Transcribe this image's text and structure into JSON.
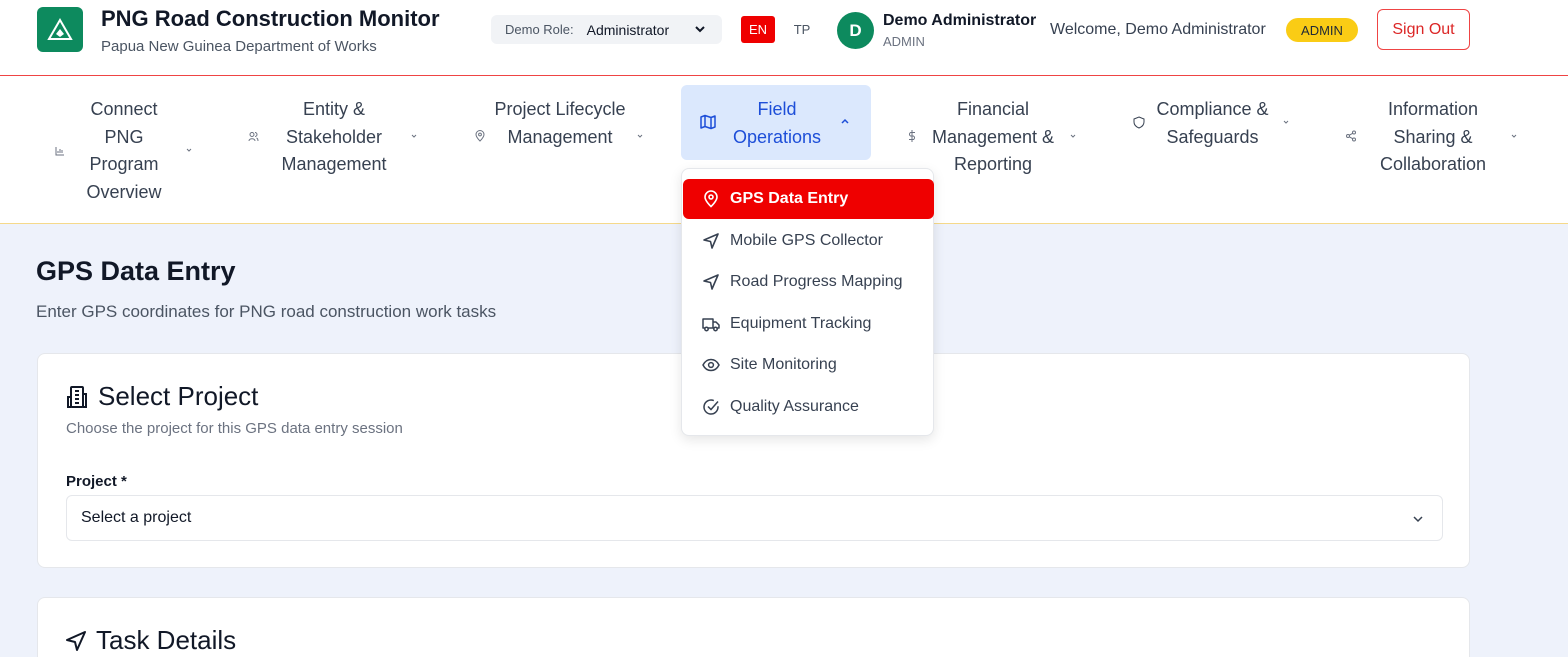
{
  "header": {
    "title": "PNG Road Construction Monitor",
    "subtitle": "Papua New Guinea Department of Works",
    "role_label": "Demo Role:",
    "role_value": "Administrator",
    "lang_en": "EN",
    "lang_tp": "TP",
    "avatar_initial": "D",
    "user_name": "Demo Administrator",
    "user_role": "ADMIN",
    "welcome": "Welcome, Demo Administrator",
    "badge": "ADMIN",
    "signout": "Sign Out",
    "brand_color": "#0d8a5e",
    "accent_color": "#ef0000"
  },
  "nav": {
    "items": [
      {
        "label": "Connect PNG Program Overview",
        "icon": "bar-chart-icon"
      },
      {
        "label": "Entity & Stakeholder Management",
        "icon": "users-icon"
      },
      {
        "label": "Project Lifecycle Management",
        "icon": "map-pin-icon"
      },
      {
        "label": "Field Operations",
        "icon": "map-icon"
      },
      {
        "label": "Financial Management & Reporting",
        "icon": "dollar-icon"
      },
      {
        "label": "Compliance & Safeguards",
        "icon": "shield-icon"
      },
      {
        "label": "Information Sharing & Collaboration",
        "icon": "share-icon"
      }
    ]
  },
  "dropdown": {
    "items": [
      {
        "label": "GPS Data Entry",
        "icon": "map-pin-icon",
        "active": true
      },
      {
        "label": "Mobile GPS Collector",
        "icon": "navigation-icon"
      },
      {
        "label": "Road Progress Mapping",
        "icon": "navigation-icon"
      },
      {
        "label": "Equipment Tracking",
        "icon": "truck-icon"
      },
      {
        "label": "Site Monitoring",
        "icon": "eye-icon"
      },
      {
        "label": "Quality Assurance",
        "icon": "check-circle-icon"
      }
    ]
  },
  "main": {
    "title": "GPS Data Entry",
    "subtitle": "Enter GPS coordinates for PNG road construction work tasks",
    "select_project": {
      "title": "Select Project",
      "description": "Choose the project for this GPS data entry session",
      "field_label": "Project *",
      "placeholder": "Select a project"
    },
    "task_details": {
      "title": "Task Details"
    }
  }
}
